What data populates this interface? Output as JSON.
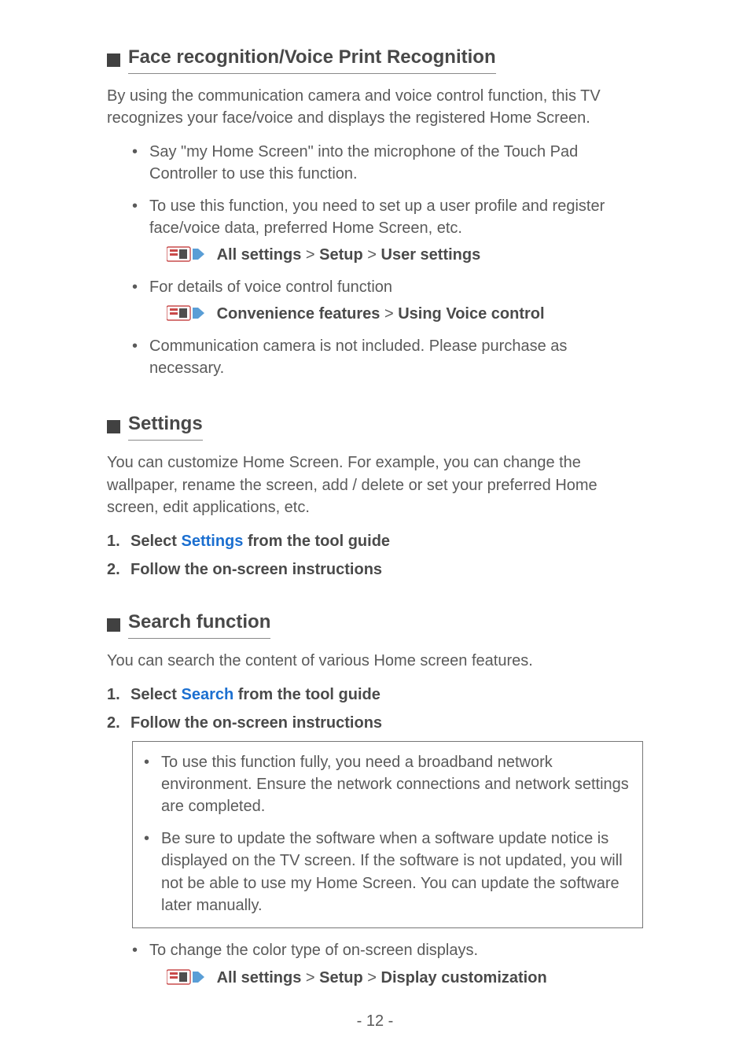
{
  "sections": {
    "face": {
      "title": "Face recognition/Voice Print Recognition",
      "intro": "By using the communication camera and voice control function, this TV recognizes your face/voice and displays the registered Home Screen.",
      "b1": "Say \"my Home Screen\" into the microphone of the Touch Pad Controller to use this function.",
      "b2": "To use this function, you need to set up a user profile and register face/voice data, preferred Home Screen, etc.",
      "ref1": {
        "p1": "All settings",
        "p2": "Setup",
        "p3": "User settings"
      },
      "b3": "For details of voice control function",
      "ref2": {
        "p1": "Convenience features",
        "p2": "Using Voice control"
      },
      "b4": "Communication camera is not included. Please purchase as necessary."
    },
    "settings": {
      "title": "Settings",
      "intro": "You can customize Home Screen. For example, you can change the wallpaper, rename the screen, add / delete or set your preferred Home screen, edit applications, etc.",
      "step1_pre": "Select ",
      "step1_link": "Settings",
      "step1_post": " from the tool guide",
      "step2": "Follow the on-screen instructions"
    },
    "search": {
      "title": "Search function",
      "intro": "You can search the content of various Home screen features.",
      "step1_pre": "Select ",
      "step1_link": "Search",
      "step1_post": " from the tool guide",
      "step2": "Follow the on-screen instructions",
      "note1": "To use this function fully, you need a broadband network environment. Ensure the network connections and network settings are completed.",
      "note2": "Be sure to update the software when a software update notice is displayed on the TV screen. If the software is not updated, you will not be able to use my Home Screen. You can update the software later manually.",
      "b1": "To change the color type of on-screen displays.",
      "ref1": {
        "p1": "All settings",
        "p2": "Setup",
        "p3": "Display customization"
      }
    }
  },
  "breadcrumb_sep": " > ",
  "page_number": "- 12 -"
}
